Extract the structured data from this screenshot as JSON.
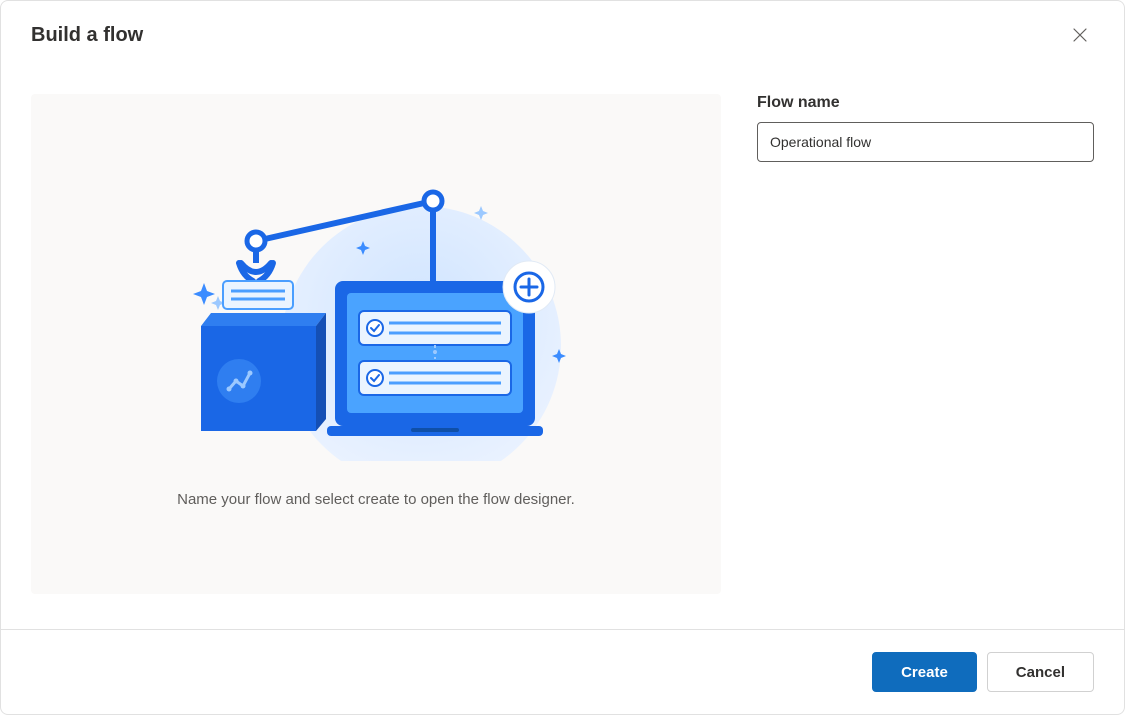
{
  "dialog": {
    "title": "Build a flow"
  },
  "illustration": {
    "caption": "Name your flow and select create to open the flow designer."
  },
  "form": {
    "flowName": {
      "label": "Flow name",
      "value": "Operational flow"
    }
  },
  "footer": {
    "createLabel": "Create",
    "cancelLabel": "Cancel"
  }
}
